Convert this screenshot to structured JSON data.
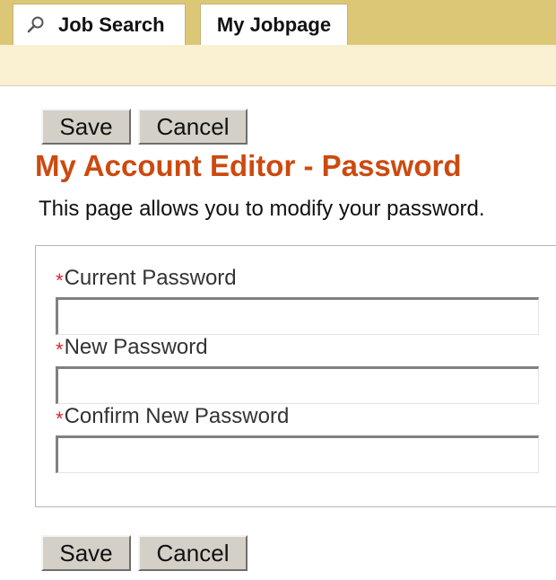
{
  "tabs": [
    {
      "label": "Job Search",
      "icon": "search-icon"
    },
    {
      "label": "My Jobpage"
    }
  ],
  "buttons": {
    "save": "Save",
    "cancel": "Cancel"
  },
  "page": {
    "title": "My Account Editor - Password",
    "description": "This page allows you to modify your password."
  },
  "form": {
    "required_marker": "*",
    "fields": [
      {
        "label": "Current Password",
        "value": ""
      },
      {
        "label": "New Password",
        "value": ""
      },
      {
        "label": "Confirm New Password",
        "value": ""
      }
    ]
  },
  "colors": {
    "tab_bar": "#dcc777",
    "sub_bar": "#f9f1d1",
    "title": "#cc4a0f",
    "required": "#e2222a",
    "button_face": "#d4d0c8"
  }
}
